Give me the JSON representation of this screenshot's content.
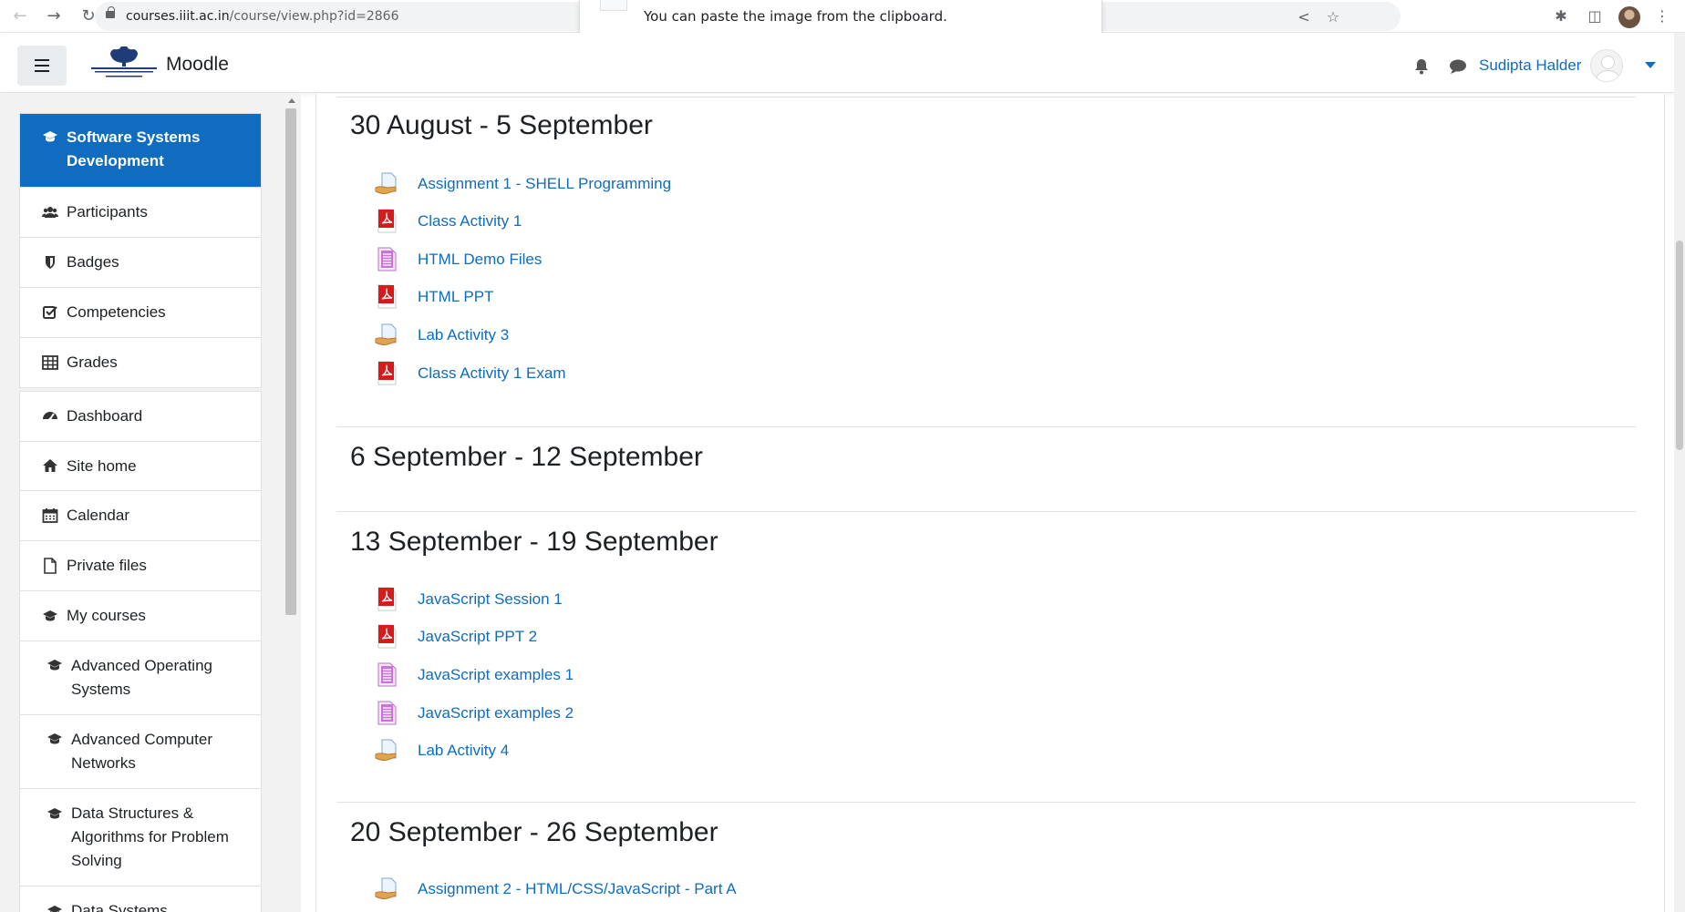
{
  "browser": {
    "url_host": "courses.iiit.ac.in",
    "url_path": "/course/view.php?id=2866",
    "toast_message": "You can paste the image from the clipboard."
  },
  "navbar": {
    "brand": "Moodle",
    "user_name": "Sudipta Halder",
    "accent_color": "#0f6cbf"
  },
  "sidebar": {
    "course_items": [
      {
        "label": "Software Systems Development",
        "icon": "graduation-cap-icon"
      },
      {
        "label": "Participants",
        "icon": "users-icon"
      },
      {
        "label": "Badges",
        "icon": "shield-icon"
      },
      {
        "label": "Competencies",
        "icon": "check-square-icon"
      },
      {
        "label": "Grades",
        "icon": "table-icon"
      }
    ],
    "site_items": [
      {
        "label": "Dashboard",
        "icon": "dashboard-icon"
      },
      {
        "label": "Site home",
        "icon": "home-icon"
      },
      {
        "label": "Calendar",
        "icon": "calendar-icon"
      },
      {
        "label": "Private files",
        "icon": "file-icon"
      },
      {
        "label": "My courses",
        "icon": "graduation-cap-icon"
      },
      {
        "label": "Advanced Operating Systems",
        "icon": "graduation-cap-icon"
      },
      {
        "label": "Advanced Computer Networks",
        "icon": "graduation-cap-icon"
      },
      {
        "label": "Data Structures & Algorithms for Problem Solving",
        "icon": "graduation-cap-icon"
      },
      {
        "label": "Data Systems",
        "icon": "graduation-cap-icon"
      }
    ]
  },
  "sections": [
    {
      "title": "30 August - 5 September",
      "activities": [
        {
          "label": "Assignment 1 - SHELL Programming",
          "icon": "assignment-icon"
        },
        {
          "label": "Class Activity 1",
          "icon": "pdf-icon"
        },
        {
          "label": "HTML Demo Files",
          "icon": "archive-icon"
        },
        {
          "label": "HTML PPT",
          "icon": "pdf-icon"
        },
        {
          "label": "Lab Activity 3",
          "icon": "assignment-icon"
        },
        {
          "label": "Class Activity 1 Exam",
          "icon": "pdf-icon"
        }
      ]
    },
    {
      "title": "6 September - 12 September",
      "activities": []
    },
    {
      "title": "13 September - 19 September",
      "activities": [
        {
          "label": "JavaScript Session 1",
          "icon": "pdf-icon"
        },
        {
          "label": "JavaScript PPT 2",
          "icon": "pdf-icon"
        },
        {
          "label": "JavaScript examples 1",
          "icon": "archive-icon"
        },
        {
          "label": "JavaScript examples 2",
          "icon": "archive-icon"
        },
        {
          "label": "Lab Activity 4",
          "icon": "assignment-icon"
        }
      ]
    },
    {
      "title": "20 September - 26 September",
      "activities": [
        {
          "label": "Assignment 2 - HTML/CSS/JavaScript - Part A",
          "icon": "assignment-icon"
        }
      ]
    }
  ]
}
